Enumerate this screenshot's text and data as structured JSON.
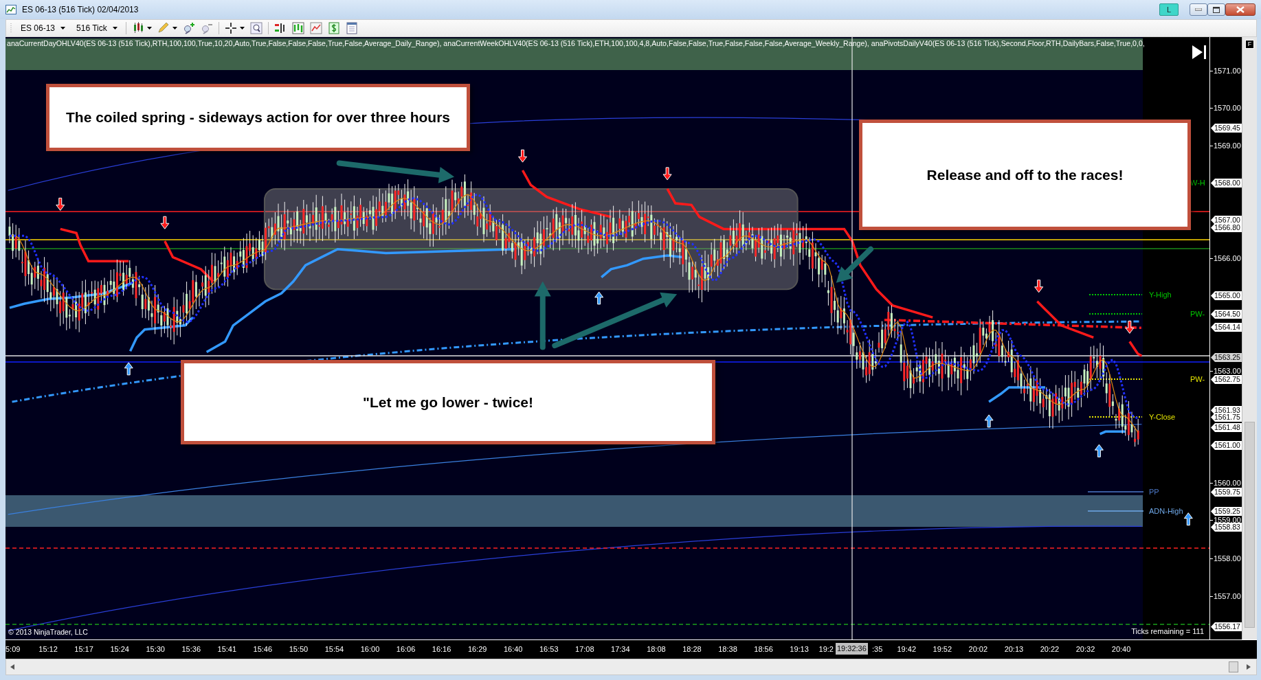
{
  "window": {
    "title": "ES 06-13 (516 Tick) 02/04/2013",
    "badge": "L"
  },
  "toolbar": {
    "instrument": "ES 06-13",
    "interval": "516 Tick"
  },
  "indicator_line": "anaCurrentDayOHLV40(ES 06-13 (516 Tick),RTH,100,100,True,10,20,Auto,True,False,False,False,True,False,Average_Daily_Range), anaCurrentWeekOHLV40(ES 06-13 (516 Tick),ETH,100,100,4,8,Auto,False,False,True,False,False,False,Average_Weekly_Range), anaPivotsDailyV40(ES 06-13 (516 Tick),Second,Floor,RTH,DailyBars,False,True,0,0,",
  "corner_button": "F",
  "annotations": [
    {
      "text": "The coiled spring - sideways action for over three hours"
    },
    {
      "text": "Release and off to the races!"
    },
    {
      "text": "\"Let me go lower - twice!"
    }
  ],
  "level_labels": [
    {
      "text": "W-H",
      "color": "#00c800"
    },
    {
      "text": "Y-High",
      "color": "#00c800"
    },
    {
      "text": "PW-",
      "color": "#00c800"
    },
    {
      "text": "PW-",
      "color": "#e6e600"
    },
    {
      "text": "Y-Close",
      "color": "#e6e600"
    },
    {
      "text": "PP",
      "color": "#4c78c8"
    },
    {
      "text": "ADN-High",
      "color": "#6fa8e8"
    }
  ],
  "price_axis": [
    {
      "text": "1571.00",
      "kind": "tick"
    },
    {
      "text": "1570.00",
      "kind": "tick"
    },
    {
      "text": "1569.45",
      "kind": "flag"
    },
    {
      "text": "1569.00",
      "kind": "tick"
    },
    {
      "text": "1568.00",
      "kind": "flag"
    },
    {
      "text": "1567.00",
      "kind": "flag"
    },
    {
      "text": "1566.80",
      "kind": "flag"
    },
    {
      "text": "1566.00",
      "kind": "tick"
    },
    {
      "text": "1565.00",
      "kind": "flag"
    },
    {
      "text": "1564.50",
      "kind": "flag"
    },
    {
      "text": "1564.14",
      "kind": "flag"
    },
    {
      "text": "1563.25",
      "kind": "current"
    },
    {
      "text": "1563.00",
      "kind": "tick"
    },
    {
      "text": "1562.75",
      "kind": "flag"
    },
    {
      "text": "1561.93",
      "kind": "flag"
    },
    {
      "text": "1561.75",
      "kind": "flag"
    },
    {
      "text": "1561.48",
      "kind": "flag"
    },
    {
      "text": "1561.00",
      "kind": "flag"
    },
    {
      "text": "1560.00",
      "kind": "tick"
    },
    {
      "text": "1559.75",
      "kind": "flag"
    },
    {
      "text": "1559.25",
      "kind": "flag"
    },
    {
      "text": "1559.00",
      "kind": "tick"
    },
    {
      "text": "1558.83",
      "kind": "flag"
    },
    {
      "text": "1558.00",
      "kind": "tick"
    },
    {
      "text": "1557.00",
      "kind": "tick"
    },
    {
      "text": "1556.17",
      "kind": "flag"
    }
  ],
  "time_axis": [
    "5:09",
    "15:12",
    "15:17",
    "15:24",
    "15:30",
    "15:36",
    "15:41",
    "15:46",
    "15:50",
    "15:54",
    "16:00",
    "16:06",
    "16:16",
    "16:29",
    "16:40",
    "16:53",
    "17:08",
    "17:34",
    "18:08",
    "18:28",
    "18:38",
    "18:56",
    "19:13",
    "19:2",
    ":35",
    "19:42",
    "19:52",
    "20:02",
    "20:13",
    "20:22",
    "20:32",
    "20:40"
  ],
  "crosshair_time": "19:32:36",
  "copyright": "© 2013 NinjaTrader, LLC",
  "ticks_remaining": "Ticks remaining = 111"
}
